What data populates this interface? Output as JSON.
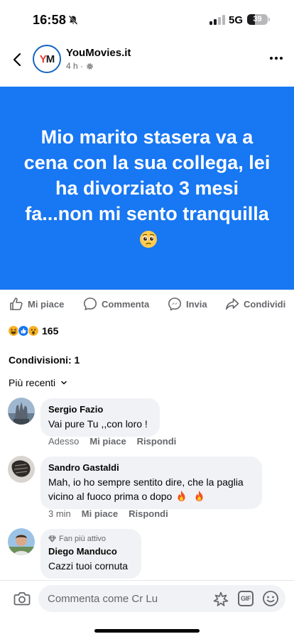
{
  "status_bar": {
    "time": "16:58",
    "network": "5G",
    "battery_level": "39",
    "battery_fraction": 0.39
  },
  "header": {
    "page_name": "YouMovies.it",
    "logo_letters": "YM",
    "post_time": "4 h ·",
    "icons": [
      "back-chevron-icon",
      "gear-icon",
      "more-dots-icon"
    ]
  },
  "post": {
    "text": "Mio marito stasera va a cena con la sua collega, lei ha divorziato 3 mesi fa...non mi sento tranquilla",
    "background_color": "#1877f2"
  },
  "actions": {
    "like": "Mi piace",
    "comment": "Commenta",
    "send": "Invia",
    "share": "Condividi"
  },
  "reactions": {
    "types": [
      "haha",
      "like",
      "wow"
    ],
    "count": "165"
  },
  "shares_text": "Condivisioni: 1",
  "sort_label": "Più recenti",
  "comments": [
    {
      "name": "Sergio Fazio",
      "text": "Vai pure Tu ,,con loro !",
      "time": "Adesso",
      "like": "Mi piace",
      "reply": "Rispondi"
    },
    {
      "name": "Sandro Gastaldi",
      "text": "Mah, io ho sempre sentito dire, che la paglia vicino al fuoco prima o dopo",
      "time": "3 min",
      "like": "Mi piace",
      "reply": "Rispondi"
    },
    {
      "badge": "Fan più attivo",
      "name": "Diego Manduco",
      "text": "Cazzi tuoi cornuta"
    }
  ],
  "composer": {
    "placeholder": "Commenta come Cr Lu",
    "gif_label": "GIF"
  }
}
